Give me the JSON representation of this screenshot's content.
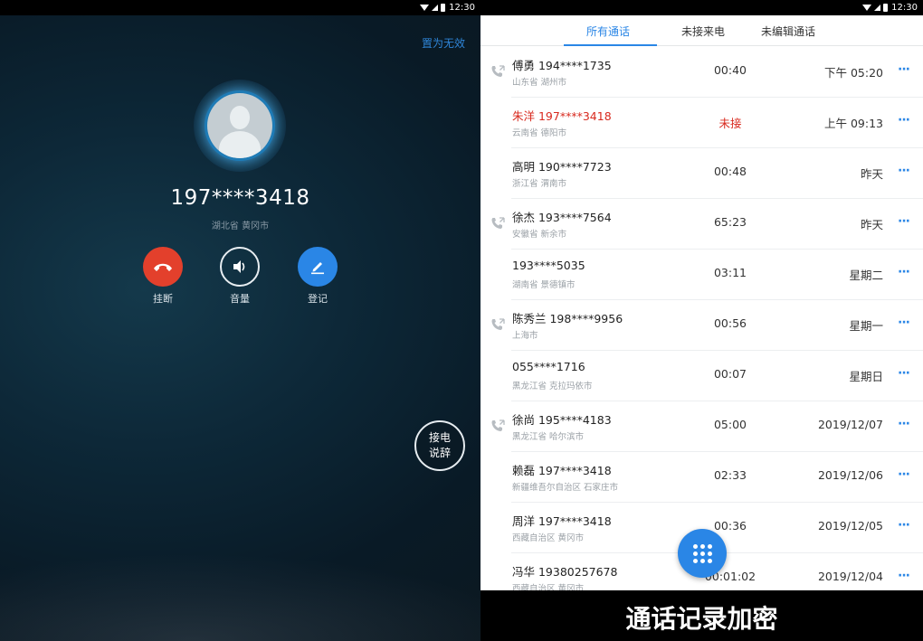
{
  "status_bar": {
    "time": "12:30"
  },
  "incoming": {
    "mark_invalid": "置为无效",
    "number": "197****3418",
    "location": "湖北省 黄冈市",
    "actions": {
      "hangup": "挂断",
      "volume": "音量",
      "register": "登记"
    },
    "answer": {
      "line1": "接电",
      "line2": "说辞"
    }
  },
  "call_log": {
    "tabs": [
      "所有通话",
      "未接来电",
      "未编辑通话"
    ],
    "active_tab": 0,
    "rows": [
      {
        "name": "傅勇 194****1735",
        "location": "山东省 湖州市",
        "duration": "00:40",
        "time": "下午 05:20",
        "missed": false,
        "callback": true
      },
      {
        "name": "朱洋 197****3418",
        "location": "云南省 德阳市",
        "duration": "未接",
        "time": "上午 09:13",
        "missed": true,
        "callback": false
      },
      {
        "name": "高明 190****7723",
        "location": "浙江省 渭南市",
        "duration": "00:48",
        "time": "昨天",
        "missed": false,
        "callback": false
      },
      {
        "name": "徐杰 193****7564",
        "location": "安徽省 新余市",
        "duration": "65:23",
        "time": "昨天",
        "missed": false,
        "callback": true
      },
      {
        "name": "193****5035",
        "location": "湖南省 景德镇市",
        "duration": "03:11",
        "time": "星期二",
        "missed": false,
        "callback": false
      },
      {
        "name": "陈秀兰 198****9956",
        "location": "上海市",
        "duration": "00:56",
        "time": "星期一",
        "missed": false,
        "callback": true
      },
      {
        "name": "055****1716",
        "location": "黑龙江省 克拉玛依市",
        "duration": "00:07",
        "time": "星期日",
        "missed": false,
        "callback": false
      },
      {
        "name": "徐尚 195****4183",
        "location": "黑龙江省 哈尔滨市",
        "duration": "05:00",
        "time": "2019/12/07",
        "missed": false,
        "callback": true
      },
      {
        "name": "赖磊 197****3418",
        "location": "新疆维吾尔自治区 石家庄市",
        "duration": "02:33",
        "time": "2019/12/06",
        "missed": false,
        "callback": false
      },
      {
        "name": "周洋 197****3418",
        "location": "西藏自治区 黄冈市",
        "duration": "00:36",
        "time": "2019/12/05",
        "missed": false,
        "callback": false
      },
      {
        "name": "冯华 19380257678",
        "location": "西藏自治区 黄冈市",
        "duration": "00:01:02",
        "time": "2019/12/04",
        "missed": false,
        "callback": false
      }
    ],
    "more_glyph": "···"
  },
  "caption": "通话记录加密",
  "colors": {
    "accent": "#2a86e6",
    "missed": "#d8291e",
    "hangup": "#e3402c"
  }
}
